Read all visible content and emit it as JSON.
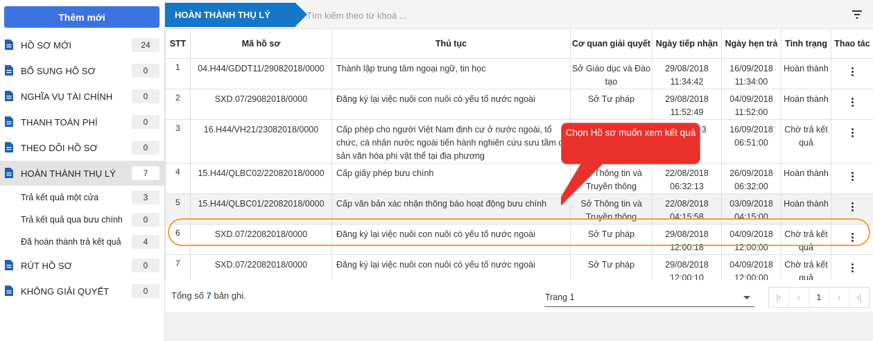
{
  "sidebar": {
    "new_button": "Thêm mới",
    "items": [
      {
        "label": "HỒ SƠ MỚI",
        "count": "24"
      },
      {
        "label": "BỔ SUNG HỒ SƠ",
        "count": "0"
      },
      {
        "label": "NGHĨA VỤ TÀI CHÍNH",
        "count": "0"
      },
      {
        "label": "THANH TOÁN PHÍ",
        "count": "0"
      },
      {
        "label": "THEO DÕI HỒ SƠ",
        "count": "0"
      },
      {
        "label": "HOÀN THÀNH THỤ LÝ",
        "count": "7"
      },
      {
        "label": "RÚT HỒ SƠ",
        "count": "0"
      },
      {
        "label": "KHÔNG GIẢI QUYẾT",
        "count": "0"
      }
    ],
    "subitems": [
      {
        "label": "Trả kết quả một cửa",
        "count": "3"
      },
      {
        "label": "Trả kết quả qua bưu chính",
        "count": "0"
      },
      {
        "label": "Đã hoàn thành trả kết quả",
        "count": "4"
      }
    ]
  },
  "header": {
    "tab_label": "HOÀN THÀNH THỤ LÝ",
    "search_placeholder": "Tìm kiếm theo từ khoá ...",
    "filter_icon": "filter-icon"
  },
  "table": {
    "columns": [
      "STT",
      "Mã hồ sơ",
      "Thủ tục",
      "Cơ quan giải quyết",
      "Ngày tiếp nhận",
      "Ngày hẹn trả",
      "Tình trạng",
      "Thao tác"
    ],
    "rows": [
      {
        "stt": "1",
        "ma": "04.H44/GDDT11/29082018/0000",
        "thutuc": "Thành lập trung tâm ngoại ngữ, tin học",
        "coquan": "Sở Giáo dục và Đào tạo",
        "tiepnhan": "29/08/2018 11:34:42",
        "hentra": "16/09/2018 11:34:00",
        "tinhtrang": "Hoàn thành"
      },
      {
        "stt": "2",
        "ma": "SXD.07/29082018/0000",
        "thutuc": "Đăng ký lại việc nuôi con nuôi có yếu tố nước ngoài",
        "coquan": "Sở Tư pháp",
        "tiepnhan": "29/08/2018 11:52:49",
        "hentra": "04/09/2018 11:52:00",
        "tinhtrang": "Hoàn thành"
      },
      {
        "stt": "3",
        "ma": "16.H44/VH21/23082018/0000",
        "thutuc": "Cấp phép cho người Việt Nam định cư ở nước ngoài, tổ chức, cá nhân nước ngoài tiến hành nghiên cứu sưu tầm di sản văn hóa phi vật thể tại địa phương",
        "coquan": "",
        "tiepnhan": "…018 …3",
        "hentra": "16/09/2018 06:51:00",
        "tinhtrang": "Chờ trả kết quả"
      },
      {
        "stt": "4",
        "ma": "15.H44/QLBC02/22082018/0000",
        "thutuc": "Cấp giấy phép bưu chính",
        "coquan": "Sở Thông tin và Truyền thông",
        "tiepnhan": "22/08/2018 06:32:13",
        "hentra": "26/09/2018 06:32:00",
        "tinhtrang": "Hoàn thành"
      },
      {
        "stt": "5",
        "ma": "15.H44/QLBC01/22082018/0000",
        "thutuc": "Cấp văn bản xác nhận thông báo hoạt động bưu chính",
        "coquan": "Sở Thông tin và Truyền thông",
        "tiepnhan": "22/08/2018 04:15:58",
        "hentra": "03/09/2018 04:15:00",
        "tinhtrang": "Hoàn thành"
      },
      {
        "stt": "6",
        "ma": "SXD.07/22082018/0000",
        "thutuc": "Đăng ký lại việc nuôi con nuôi có yếu tố nước ngoài",
        "coquan": "Sở Tư pháp",
        "tiepnhan": "29/08/2018 12:00:18",
        "hentra": "04/09/2018 12:00:00",
        "tinhtrang": "Chờ trả kết quả"
      },
      {
        "stt": "7",
        "ma": "SXD.07/22082018/0000",
        "thutuc": "Đăng ký lại việc nuôi con nuôi có yếu tố nước ngoài",
        "coquan": "Sở Tư pháp",
        "tiepnhan": "29/08/2018 12:00:10",
        "hentra": "04/09/2018 12:00:00",
        "tinhtrang": "Chờ trả kết quả"
      }
    ]
  },
  "footer": {
    "total_prefix": "Tổng số",
    "total_count": "7",
    "total_suffix": "bản ghi.",
    "page_select": "Trang 1",
    "current_page": "1"
  },
  "callout": {
    "text": "Chọn Hồ sơ muốn xem kết quả",
    "fill_color": "#e8302c",
    "highlight_color": "#f0a030"
  },
  "colors": {
    "accent": "#1577c7",
    "button": "#3b72e0"
  }
}
